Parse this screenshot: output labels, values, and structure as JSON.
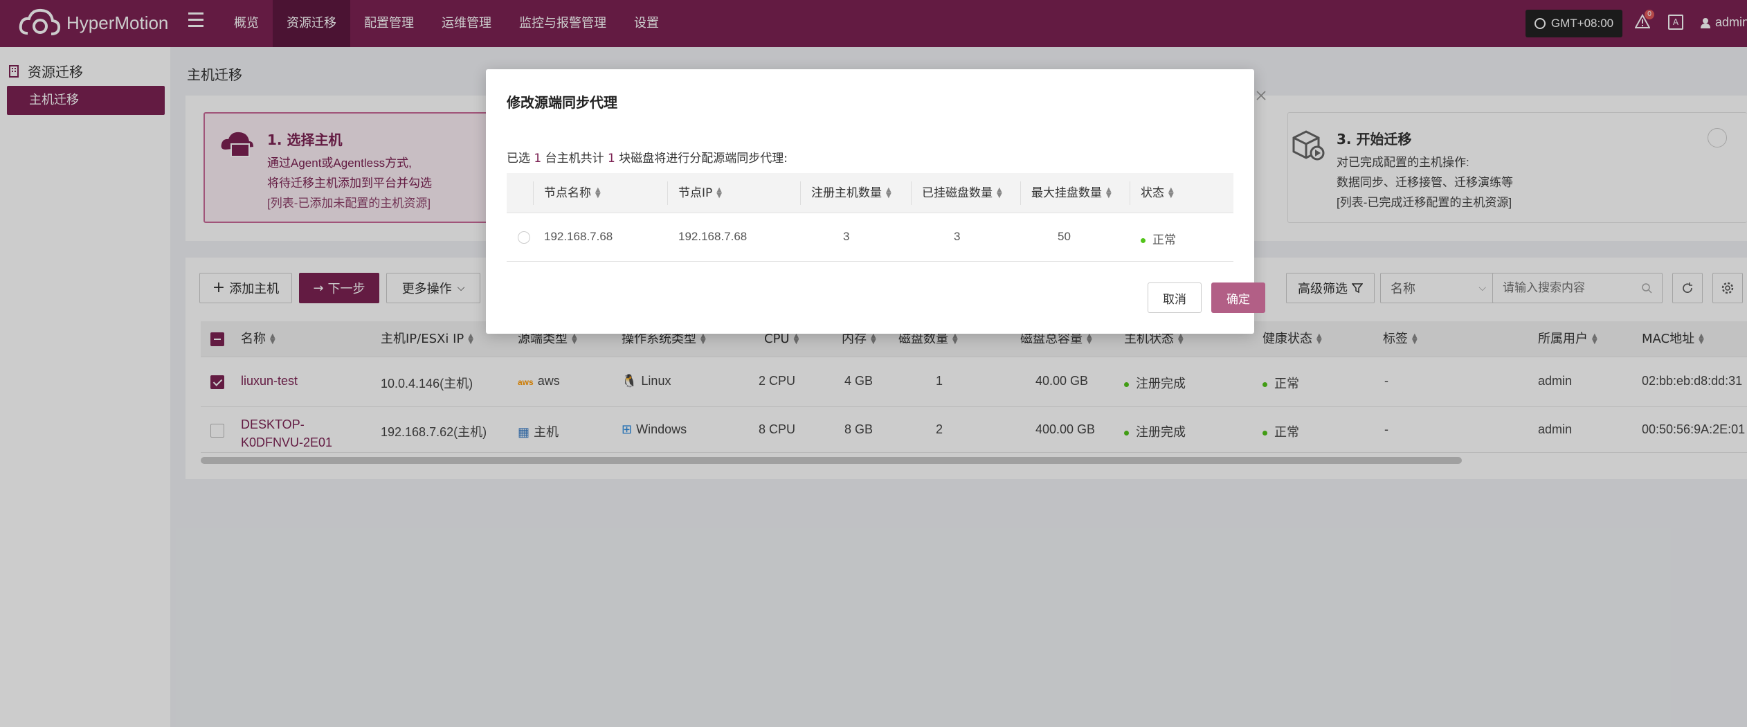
{
  "app": {
    "name": "HyperMotion"
  },
  "nav": {
    "items": [
      {
        "label": "概览"
      },
      {
        "label": "资源迁移"
      },
      {
        "label": "配置管理"
      },
      {
        "label": "运维管理"
      },
      {
        "label": "监控与报警管理"
      },
      {
        "label": "设置"
      }
    ],
    "timezone": "GMT+08:00",
    "alert_count": "0",
    "user": "admin"
  },
  "sidebar": {
    "title": "资源迁移",
    "items": [
      {
        "label": "主机迁移"
      }
    ]
  },
  "page": {
    "title": "主机迁移"
  },
  "steps": {
    "step1": {
      "title": "1. 选择主机",
      "line1": "通过Agent或Agentless方式,",
      "line2": "将待迁移主机添加到平台并勾选",
      "line3": "[列表-已添加未配置的主机资源]"
    },
    "step3": {
      "title": "3. 开始迁移",
      "line1": "对已完成配置的主机操作:",
      "line2": "数据同步、迁移接管、迁移演练等",
      "line3": "[列表-已完成迁移配置的主机资源]"
    }
  },
  "toolbar": {
    "add_host": "添加主机",
    "next_step": "下一步",
    "more_actions": "更多操作",
    "advanced_filter": "高级筛选",
    "filter_field": "名称",
    "search_placeholder": "请输入搜索内容"
  },
  "table": {
    "columns": [
      "名称",
      "主机IP/ESXi IP",
      "源端类型",
      "操作系统类型",
      "CPU",
      "内存",
      "磁盘数量",
      "磁盘总容量",
      "主机状态",
      "健康状态",
      "标签",
      "所属用户",
      "MAC地址"
    ],
    "rows": [
      {
        "checked": true,
        "name": "liuxun-test",
        "name_line2": "",
        "ip": "10.0.4.146(主机)",
        "source_type": "aws",
        "os": "Linux",
        "cpu": "2 CPU",
        "memory": "4 GB",
        "disk_count": "1",
        "disk_total": "40.00 GB",
        "host_status": "注册完成",
        "health": "正常",
        "tag": "-",
        "owner": "admin",
        "mac": "02:bb:eb:d8:dd:31"
      },
      {
        "checked": false,
        "name": "DESKTOP-",
        "name_line2": "K0DFNVU-2E01",
        "ip": "192.168.7.62(主机)",
        "source_type": "主机",
        "os": "Windows",
        "cpu": "8 CPU",
        "memory": "8 GB",
        "disk_count": "2",
        "disk_total": "400.00 GB",
        "host_status": "注册完成",
        "health": "正常",
        "tag": "-",
        "owner": "admin",
        "mac": "00:50:56:9A:2E:01"
      }
    ]
  },
  "modal": {
    "title": "修改源端同步代理",
    "desc_prefix": "已选",
    "desc_hosts": "1",
    "desc_mid": "台主机共计",
    "desc_disks": "1",
    "desc_suffix": "块磁盘将进行分配源端同步代理:",
    "columns": [
      "节点名称",
      "节点IP",
      "注册主机数量",
      "已挂磁盘数量",
      "最大挂盘数量",
      "状态"
    ],
    "rows": [
      {
        "node_name": "192.168.7.68",
        "node_ip": "192.168.7.68",
        "registered_hosts": "3",
        "mounted_disks": "3",
        "max_disks": "50",
        "status": "正常"
      }
    ],
    "cancel": "取消",
    "confirm": "确定"
  },
  "colors": {
    "brand": "#7c2253",
    "ok": "#52c41a"
  }
}
